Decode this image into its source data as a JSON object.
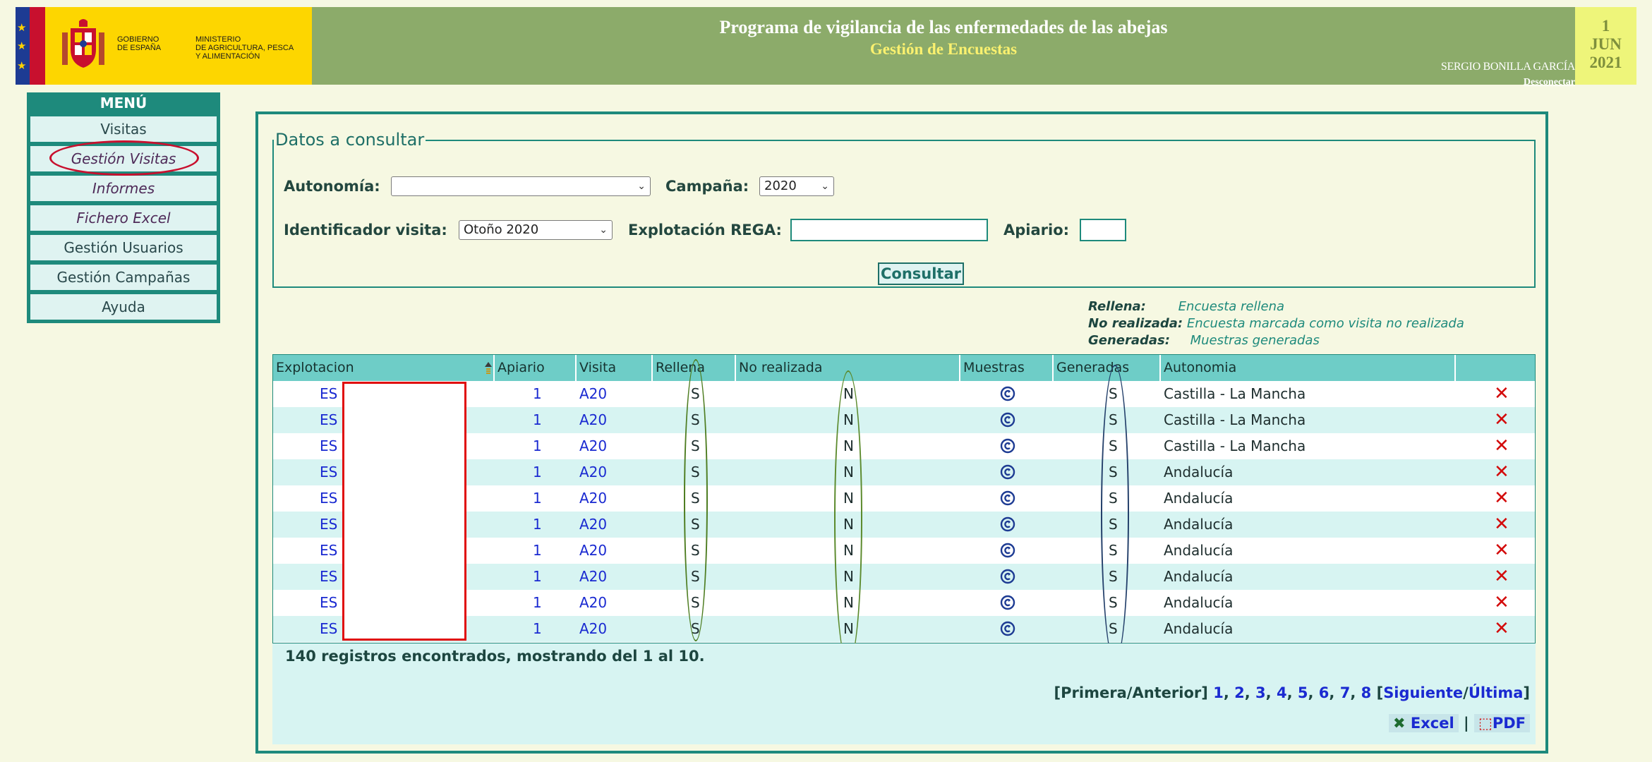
{
  "header": {
    "gov_name": "Gobierno\nde España",
    "ministry_name": "Ministerio\nde Agricultura, Pesca\ny Alimentación",
    "title": "Programa de vigilancia de las enfermedades de las abejas",
    "subtitle": "Gestión de Encuestas",
    "user": "SERGIO BONILLA GARCÍA",
    "logout": "Desconectar",
    "date": {
      "day": "1",
      "month": "JUN",
      "year": "2021"
    }
  },
  "menu": {
    "title": "MENÚ",
    "items": [
      {
        "label": "Visitas"
      },
      {
        "label": "Gestión Visitas"
      },
      {
        "label": "Informes"
      },
      {
        "label": "Fichero Excel"
      },
      {
        "label": "Gestión Usuarios"
      },
      {
        "label": "Gestión Campañas"
      },
      {
        "label": "Ayuda"
      }
    ]
  },
  "filters": {
    "legend": "Datos a consultar",
    "autonomia_label": "Autonomía:",
    "autonomia_value": "",
    "campana_label": "Campaña:",
    "campana_value": "2020",
    "visita_label": "Identificador visita:",
    "visita_value": "Otoño 2020",
    "rega_label": "Explotación REGA:",
    "rega_value": "",
    "apiario_label": "Apiario:",
    "apiario_value": "",
    "submit": "Consultar"
  },
  "key": [
    {
      "term": "Rellena:",
      "desc": "Encuesta rellena"
    },
    {
      "term": "No realizada:",
      "desc": "Encuesta marcada como visita no realizada"
    },
    {
      "term": "Generadas:",
      "desc": "Muestras generadas"
    }
  ],
  "table": {
    "headers": [
      "Explotacion",
      "Apiario",
      "Visita",
      "Rellena",
      "No realizada",
      "Muestras",
      "Generadas",
      "Autonomia"
    ],
    "rows": [
      {
        "explotacion": "ES",
        "apiario": "1",
        "visita": "A20",
        "rellena": "S",
        "no_realizada": "N",
        "generadas": "S",
        "autonomia": "Castilla - La Mancha"
      },
      {
        "explotacion": "ES",
        "apiario": "1",
        "visita": "A20",
        "rellena": "S",
        "no_realizada": "N",
        "generadas": "S",
        "autonomia": "Castilla - La Mancha"
      },
      {
        "explotacion": "ES",
        "apiario": "1",
        "visita": "A20",
        "rellena": "S",
        "no_realizada": "N",
        "generadas": "S",
        "autonomia": "Castilla - La Mancha"
      },
      {
        "explotacion": "ES",
        "apiario": "1",
        "visita": "A20",
        "rellena": "S",
        "no_realizada": "N",
        "generadas": "S",
        "autonomia": "Andalucía"
      },
      {
        "explotacion": "ES",
        "apiario": "1",
        "visita": "A20",
        "rellena": "S",
        "no_realizada": "N",
        "generadas": "S",
        "autonomia": "Andalucía"
      },
      {
        "explotacion": "ES",
        "apiario": "1",
        "visita": "A20",
        "rellena": "S",
        "no_realizada": "N",
        "generadas": "S",
        "autonomia": "Andalucía"
      },
      {
        "explotacion": "ES",
        "apiario": "1",
        "visita": "A20",
        "rellena": "S",
        "no_realizada": "N",
        "generadas": "S",
        "autonomia": "Andalucía"
      },
      {
        "explotacion": "ES",
        "apiario": "1",
        "visita": "A20",
        "rellena": "S",
        "no_realizada": "N",
        "generadas": "S",
        "autonomia": "Andalucía"
      },
      {
        "explotacion": "ES",
        "apiario": "1",
        "visita": "A20",
        "rellena": "S",
        "no_realizada": "N",
        "generadas": "S",
        "autonomia": "Andalucía"
      },
      {
        "explotacion": "ES",
        "apiario": "1",
        "visita": "A20",
        "rellena": "S",
        "no_realizada": "N",
        "generadas": "S",
        "autonomia": "Andalucía"
      }
    ]
  },
  "footer": {
    "records": "140 registros encontrados, mostrando del 1 al 10.",
    "pager_first": "Primera",
    "pager_prev": "Anterior",
    "pages": [
      "1",
      "2",
      "3",
      "4",
      "5",
      "6",
      "7",
      "8"
    ],
    "pager_next": "Siguiente",
    "pager_last": "Última",
    "excel": "Excel",
    "pdf": "PDF"
  },
  "colors": {
    "accent": "#1e8a7c",
    "header_bg": "#8cab6a",
    "link": "#1a2ad1",
    "delete": "#d30b0b"
  }
}
